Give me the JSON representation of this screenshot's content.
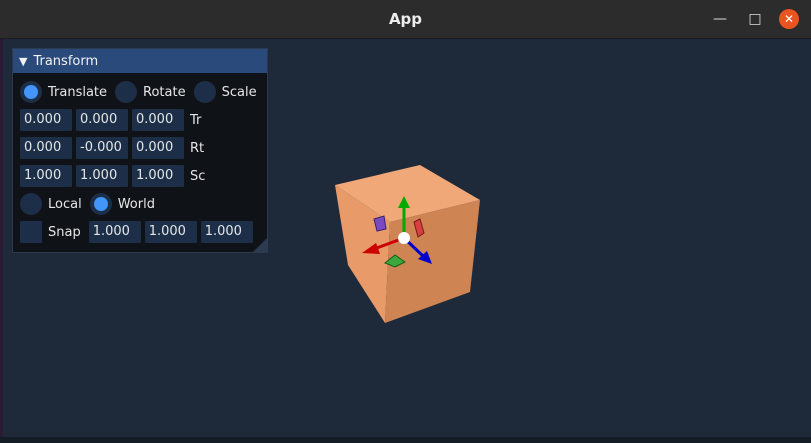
{
  "window": {
    "title": "App",
    "minimize_icon": "minimize-icon",
    "maximize_icon": "maximize-icon",
    "close_icon": "close-icon"
  },
  "panel": {
    "title": "Transform",
    "operation": {
      "options": [
        "Translate",
        "Rotate",
        "Scale"
      ],
      "selected": "Translate"
    },
    "translate": {
      "values": [
        "0.000",
        "0.000",
        "0.000"
      ],
      "label": "Tr"
    },
    "rotate": {
      "values": [
        "0.000",
        "-0.000",
        "0.000"
      ],
      "label": "Rt"
    },
    "scale": {
      "values": [
        "1.000",
        "1.000",
        "1.000"
      ],
      "label": "Sc"
    },
    "space": {
      "options": [
        "Local",
        "World"
      ],
      "selected": "World"
    },
    "snap": {
      "label": "Snap",
      "checked": false,
      "values": [
        "1.000",
        "1.000",
        "1.000"
      ]
    }
  },
  "colors": {
    "background": "#1e2a3a",
    "panel_header": "#294a7a",
    "accent": "#4296fa",
    "cube": "#e8a070",
    "axis_x": "#cc0000",
    "axis_y": "#00aa00",
    "axis_z": "#0000cc"
  }
}
